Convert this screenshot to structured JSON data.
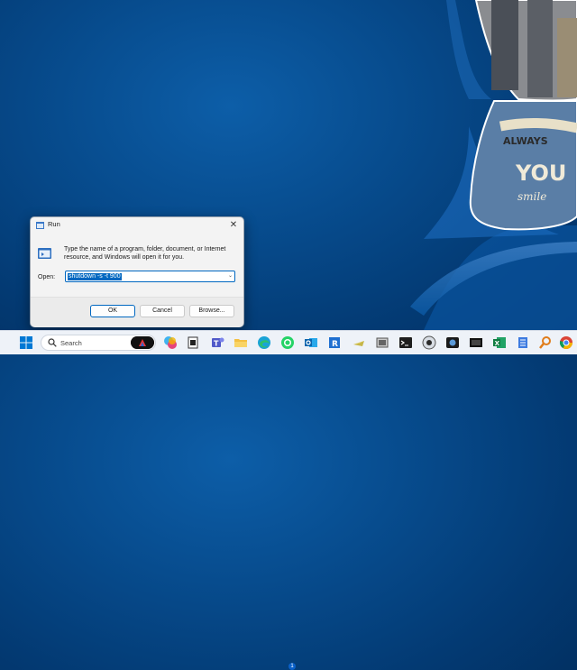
{
  "run_dialog": {
    "title": "Run",
    "description": "Type the name of a program, folder, document, or Internet resource, and Windows will open it for you.",
    "open_label": "Open:",
    "open_value": "shutdown -s -t 900",
    "close_glyph": "✕",
    "chevron_glyph": "⌄",
    "buttons": {
      "ok": "OK",
      "cancel": "Cancel",
      "browse": "Browse..."
    }
  },
  "wallpaper": {
    "photo_text_top": "ALWAYS",
    "photo_text_mid": "YOU",
    "photo_text_script": "smile"
  },
  "taskbar": {
    "search_placeholder": "Search",
    "badge_count": "1",
    "icons": [
      "windows-start-icon",
      "search-icon",
      "copilot-icon",
      "file-icon",
      "teams-icon",
      "file-explorer-icon",
      "edge-icon",
      "whatsapp-icon",
      "outlook-icon",
      "rdp-icon",
      "mail-icon",
      "terminal-icon",
      "media-icon",
      "screen-icon",
      "excel-icon",
      "notepad-icon",
      "search-app-icon",
      "chrome-icon"
    ]
  },
  "colors": {
    "accent": "#0067c0",
    "desktop": "#074c8e"
  }
}
